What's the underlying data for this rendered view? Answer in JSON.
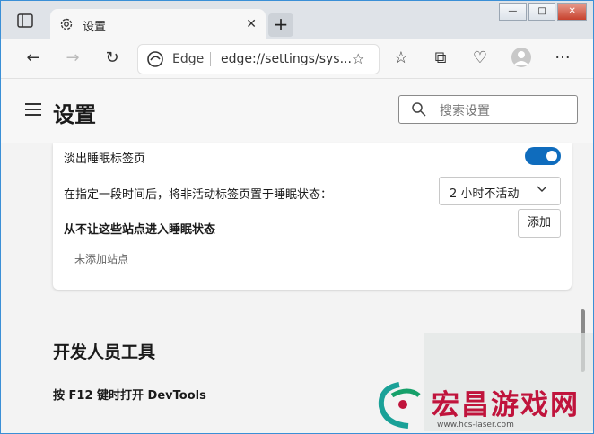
{
  "tab": {
    "title": "设置"
  },
  "toolbar": {
    "edge_label": "Edge",
    "url": "edge://settings/sys..."
  },
  "header": {
    "title": "设置",
    "search_placeholder": "搜索设置"
  },
  "sleeping_tabs": {
    "fade_label": "淡出睡眠标签页",
    "fade_enabled": true,
    "timeout_label": "在指定一段时间后，将非活动标签页置于睡眠状态：",
    "timeout_value": "2 小时不活动",
    "never_sleep_label": "从不让这些站点进入睡眠状态",
    "add_label": "添加",
    "empty_text": "未添加站点"
  },
  "developer": {
    "section_title": "开发人员工具",
    "devtools_label": "按 F12 键时打开 DevTools"
  },
  "watermark": {
    "text": "宏昌游戏网",
    "url": "www.hcs-laser.com"
  },
  "colors": {
    "accent": "#0f6cbd",
    "watermark": "#c0143c"
  },
  "icons": [
    "tab-actions-icon",
    "gear-icon",
    "close-icon",
    "plus-icon",
    "back-icon",
    "forward-icon",
    "refresh-icon",
    "edge-logo-icon",
    "add-favorite-icon",
    "favorites-icon",
    "collections-icon",
    "browser-essentials-icon",
    "profile-icon",
    "more-icon",
    "menu-icon",
    "search-icon",
    "chevron-down-icon"
  ]
}
